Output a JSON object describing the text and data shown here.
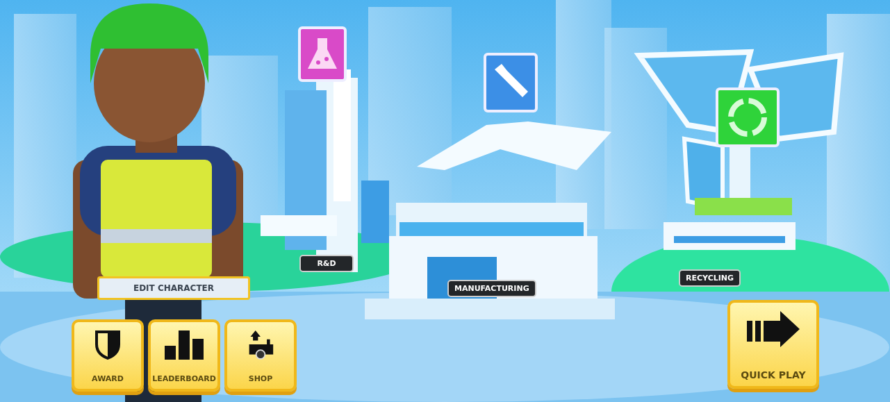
{
  "character": {
    "edit_button": "EDIT CHARACTER"
  },
  "buildings": [
    {
      "kind": "lab",
      "label": "R&D"
    },
    {
      "kind": "factory",
      "label": "MANUFACTURING"
    },
    {
      "kind": "recycle",
      "label": "RECYCLING"
    }
  ],
  "menu_buttons": [
    {
      "kind": "award",
      "label": "AWARD"
    },
    {
      "kind": "leaderboard",
      "label": "LEADERBOARD"
    },
    {
      "kind": "shop",
      "label": "SHOP"
    }
  ],
  "quick_play": {
    "label": "QUICK PLAY"
  }
}
